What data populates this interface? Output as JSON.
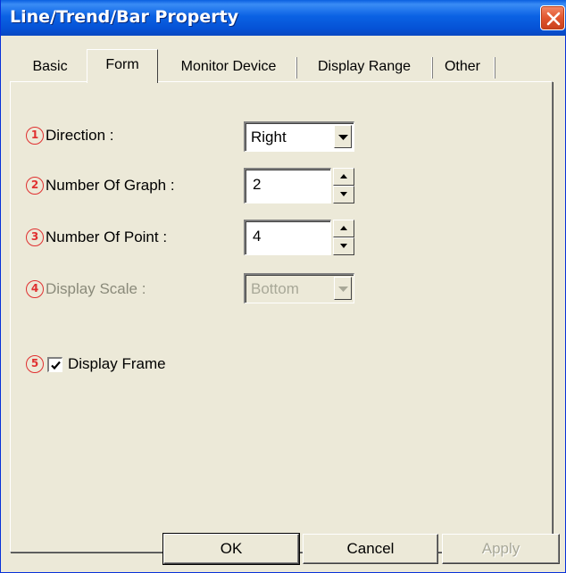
{
  "window": {
    "title": "Line/Trend/Bar Property"
  },
  "tabs": [
    {
      "label": "Basic"
    },
    {
      "label": "Form",
      "active": true
    },
    {
      "label": "Monitor Device"
    },
    {
      "label": "Display Range"
    },
    {
      "label": "Other"
    }
  ],
  "form": {
    "direction": {
      "num": "1",
      "label": "Direction :",
      "value": "Right"
    },
    "graph_count": {
      "num": "2",
      "label": "Number Of Graph :",
      "value": "2"
    },
    "point_count": {
      "num": "3",
      "label": "Number Of Point :",
      "value": "4"
    },
    "display_scale": {
      "num": "4",
      "label": "Display Scale :",
      "value": "Bottom",
      "disabled": true
    },
    "display_frame": {
      "num": "5",
      "label": "Display Frame",
      "checked": true
    }
  },
  "buttons": {
    "ok": "OK",
    "cancel": "Cancel",
    "apply": "Apply"
  },
  "colors": {
    "title_bar": "#0552d6",
    "marker_red": "#e03030",
    "dialog_bg": "#ece9d8"
  }
}
